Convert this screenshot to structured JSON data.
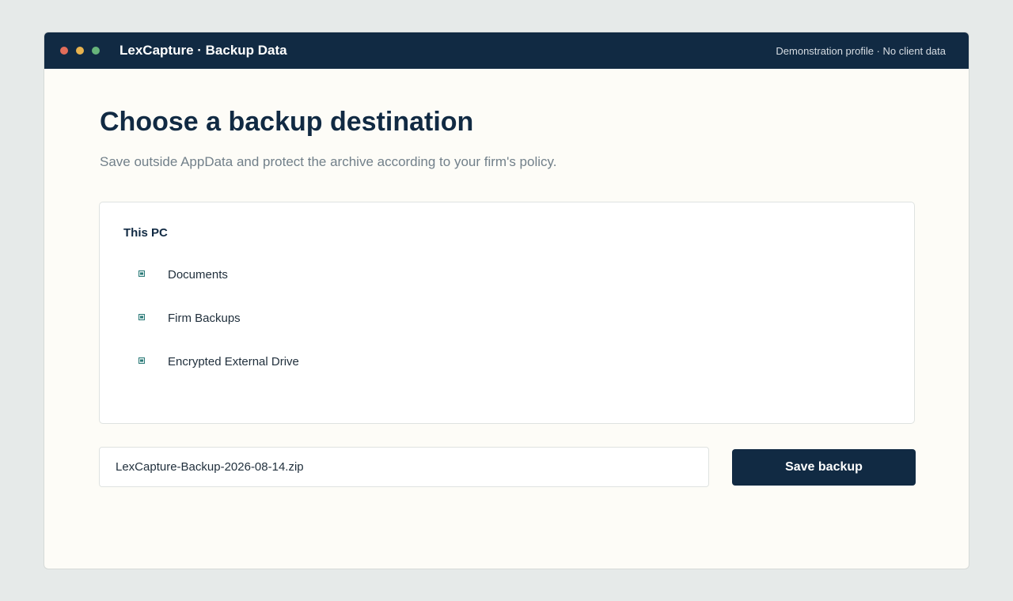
{
  "window": {
    "title": "LexCapture · Backup Data",
    "profile_note": "Demonstration profile · No client data",
    "controls": [
      "close",
      "minimize",
      "maximize"
    ]
  },
  "main": {
    "heading": "Choose a backup destination",
    "subheading": "Save outside AppData and protect the archive according to your firm's policy."
  },
  "destinations": {
    "group_label": "This PC",
    "items": [
      {
        "label": "Documents",
        "icon": "folder-icon"
      },
      {
        "label": "Firm Backups",
        "icon": "folder-icon"
      },
      {
        "label": "Encrypted External Drive",
        "icon": "drive-icon"
      }
    ]
  },
  "filename": {
    "value": "LexCapture-Backup-2026-08-14.zip"
  },
  "actions": {
    "save_label": "Save backup"
  },
  "colors": {
    "brand_navy": "#112a43",
    "background": "#fdfcf7",
    "muted_text": "#72808a",
    "dot_red": "#e26d5a",
    "dot_yellow": "#e8b34f",
    "dot_green": "#67b47a",
    "icon_teal": "#2b7a78"
  }
}
